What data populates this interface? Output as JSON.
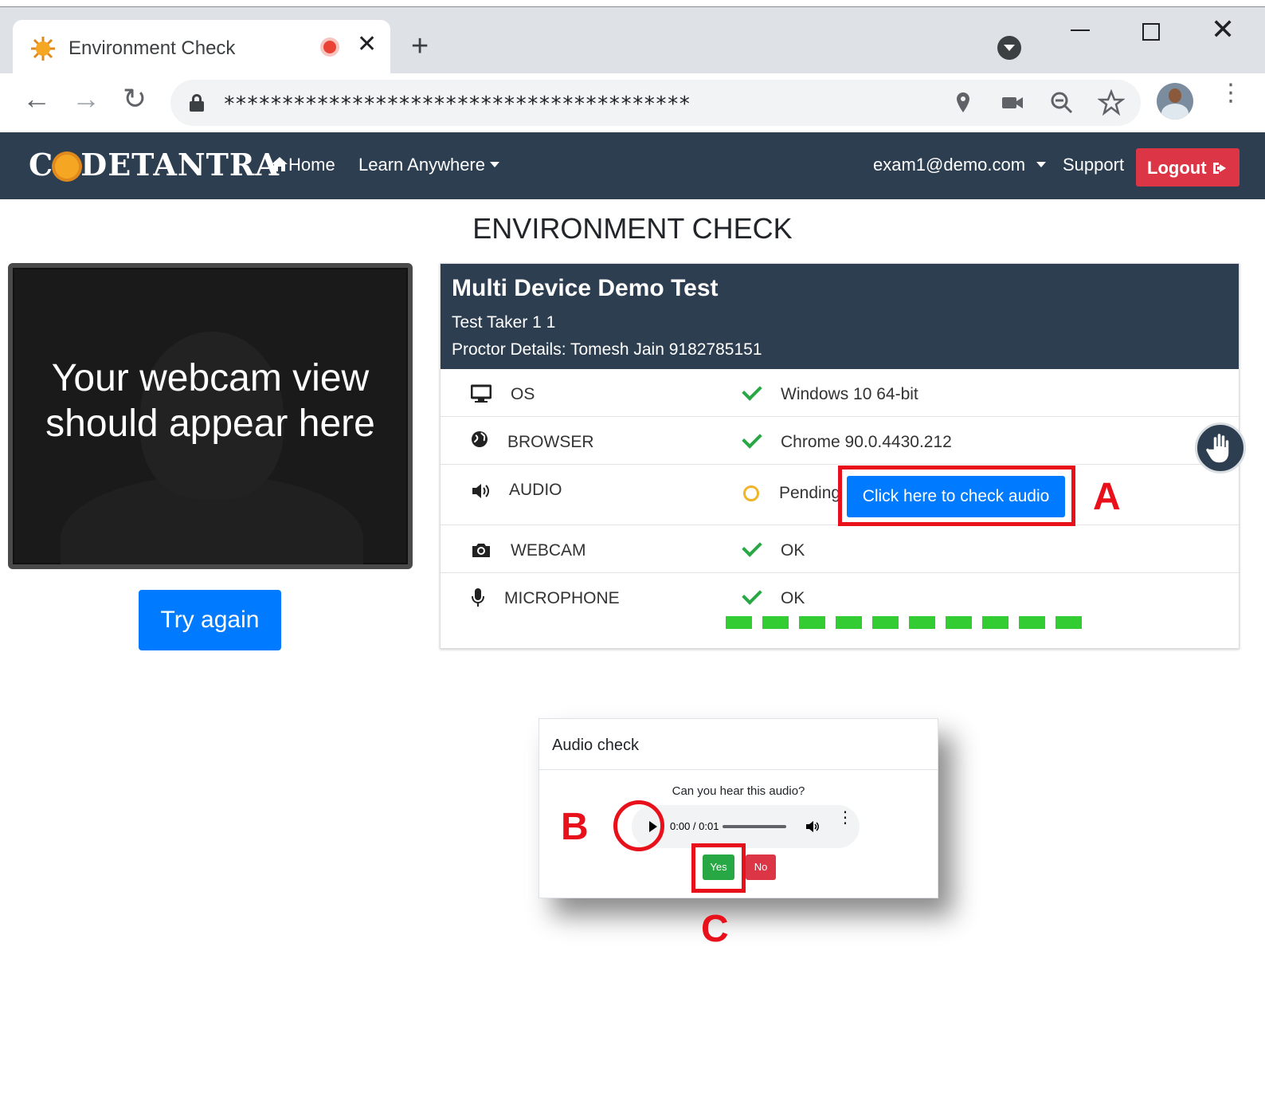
{
  "browser": {
    "tab_title": "Environment Check",
    "url": "****************************************",
    "icons": [
      "sun-favicon-icon",
      "recording-icon",
      "close-icon",
      "plus-icon",
      "back-icon",
      "forward-icon",
      "reload-icon",
      "lock-icon",
      "location-icon",
      "camera-icon",
      "zoom-icon",
      "star-icon",
      "kebab-icon"
    ]
  },
  "navbar": {
    "brand_pre": "C",
    "brand_post": "DETANTRA",
    "home": "Home",
    "learn": "Learn Anywhere",
    "user": "exam1@demo.com",
    "support": "Support",
    "logout": "Logout"
  },
  "page": {
    "title": "ENVIRONMENT CHECK"
  },
  "webcam": {
    "message": "Your webcam view should appear here",
    "try_again": "Try again"
  },
  "test": {
    "name": "Multi Device Demo Test",
    "taker": "Test Taker 1 1",
    "proctor": "Proctor Details: Tomesh Jain 9182785151"
  },
  "checks": [
    {
      "label": "OS",
      "value": "Windows 10 64-bit",
      "status": "ok"
    },
    {
      "label": "BROWSER",
      "value": "Chrome 90.0.4430.212",
      "status": "ok"
    },
    {
      "label": "AUDIO",
      "value": "Pending",
      "status": "pending",
      "action": "Click here to check audio"
    },
    {
      "label": "WEBCAM",
      "value": "OK",
      "status": "ok"
    },
    {
      "label": "MICROPHONE",
      "value": "OK",
      "status": "ok",
      "mic_level": 1.0
    }
  ],
  "modal": {
    "title": "Audio check",
    "question": "Can you hear this audio?",
    "time": "0:00 / 0:01",
    "yes": "Yes",
    "no": "No"
  },
  "annotations": {
    "a": "A",
    "b": "B",
    "c": "C"
  },
  "colors": {
    "navbar": "#2d3e50",
    "primary": "#007bff",
    "danger": "#dc3545",
    "success": "#28a745",
    "annotation": "#e8101a"
  }
}
